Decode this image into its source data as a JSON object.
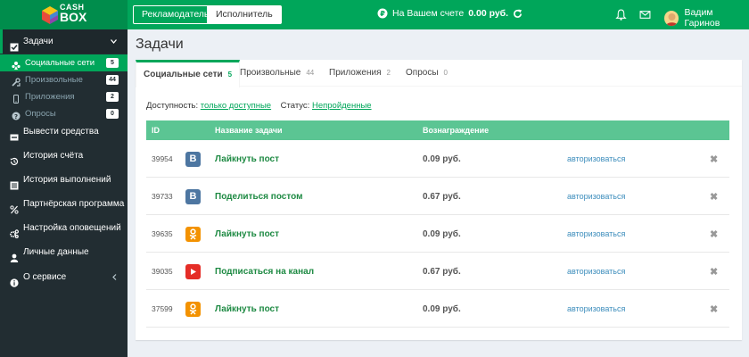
{
  "header": {
    "logo_top": "CASH",
    "logo_bottom": "BOX",
    "advertiser_label": "Рекламодатель",
    "performer_label": "Исполнитель",
    "balance_prefix": "На Вашем счете",
    "balance_value": "0.00 руб.",
    "user_name": "Вадим Гаринов"
  },
  "sidebar": {
    "tasks_label": "Задачи",
    "sub_items": [
      {
        "label": "Социальные сети",
        "count": "5",
        "icon": "users-icon"
      },
      {
        "label": "Произвольные",
        "count": "44",
        "icon": "tools-icon"
      },
      {
        "label": "Приложения",
        "count": "2",
        "icon": "mobile-icon"
      },
      {
        "label": "Опросы",
        "count": "0",
        "icon": "question-icon"
      }
    ],
    "items": [
      {
        "label": "Вывести средства",
        "icon": "wallet-icon"
      },
      {
        "label": "История счёта",
        "icon": "history-icon"
      },
      {
        "label": "История выполнений",
        "icon": "list-icon"
      },
      {
        "label": "Партнёрская программа",
        "icon": "percent-icon"
      },
      {
        "label": "Настройка оповещений",
        "icon": "cogs-icon"
      },
      {
        "label": "Личные данные",
        "icon": "user-icon"
      },
      {
        "label": "О сервисе",
        "icon": "info-icon"
      }
    ]
  },
  "main": {
    "title": "Задачи",
    "tabs": [
      {
        "label": "Социальные сети",
        "count": "5"
      },
      {
        "label": "Произвольные",
        "count": "44"
      },
      {
        "label": "Приложения",
        "count": "2"
      },
      {
        "label": "Опросы",
        "count": "0"
      }
    ],
    "filters": {
      "availability_label": "Доступность:",
      "availability_value": "только доступные",
      "status_label": "Статус:",
      "status_value": "Непройденные"
    },
    "columns": {
      "id": "ID",
      "name": "Название задачи",
      "reward": "Вознаграждение"
    },
    "rows": [
      {
        "id": "39954",
        "network": "vk",
        "title": "Лайкнуть пост",
        "reward": "0.09 руб.",
        "action": "авторизоваться",
        "close": "✖"
      },
      {
        "id": "39733",
        "network": "vk",
        "title": "Поделиться постом",
        "reward": "0.67 руб.",
        "action": "авторизоваться",
        "close": "✖"
      },
      {
        "id": "39635",
        "network": "ok",
        "title": "Лайкнуть пост",
        "reward": "0.09 руб.",
        "action": "авторизоваться",
        "close": "✖"
      },
      {
        "id": "39035",
        "network": "youtube",
        "title": "Подписаться на канал",
        "reward": "0.67 руб.",
        "action": "авторизоваться",
        "close": "✖"
      },
      {
        "id": "37599",
        "network": "ok",
        "title": "Лайкнуть пост",
        "reward": "0.09 руб.",
        "action": "авторизоваться",
        "close": "✖"
      }
    ],
    "network_glyphs": {
      "vk": "B",
      "ok": "ОК",
      "youtube": "▶"
    }
  },
  "colors": {
    "brand_green": "#00a65a",
    "sidebar_dark": "#222d32",
    "table_head": "#5bc593",
    "link_blue": "#3c8dbc"
  }
}
